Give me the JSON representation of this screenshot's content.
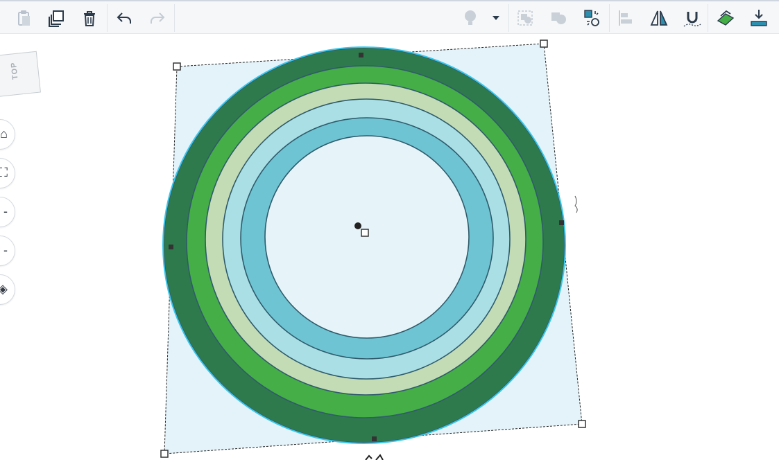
{
  "toolbar": {
    "left_tools": [
      {
        "name": "paste",
        "icon": "paste-icon",
        "enabled": false
      },
      {
        "name": "duplicate",
        "icon": "duplicate-icon",
        "enabled": true
      },
      {
        "name": "delete",
        "icon": "trash-icon",
        "enabled": true
      },
      {
        "name": "undo",
        "icon": "undo-icon",
        "enabled": true
      },
      {
        "name": "redo",
        "icon": "redo-icon",
        "enabled": false
      }
    ],
    "right_tools": [
      {
        "name": "light",
        "icon": "lightbulb-icon",
        "enabled": false
      },
      {
        "name": "light-dropdown",
        "icon": "caret-down-icon",
        "enabled": true
      },
      {
        "name": "group",
        "icon": "group-icon",
        "enabled": false
      },
      {
        "name": "ungroup",
        "icon": "ungroup-icon",
        "enabled": false
      },
      {
        "name": "cruise",
        "icon": "cruise-icon",
        "enabled": true
      },
      {
        "name": "align",
        "icon": "align-icon",
        "enabled": false
      },
      {
        "name": "mirror",
        "icon": "mirror-icon",
        "enabled": true
      },
      {
        "name": "magnet",
        "icon": "magnet-icon",
        "enabled": true
      },
      {
        "name": "workplane",
        "icon": "workplane-icon",
        "enabled": true
      },
      {
        "name": "drop",
        "icon": "drop-to-workplane-icon",
        "enabled": true
      }
    ]
  },
  "viewcube": {
    "face_label": "TOP"
  },
  "nav_controls": [
    {
      "name": "home-view",
      "glyph": "⌂"
    },
    {
      "name": "fit-view",
      "glyph": "⛶"
    },
    {
      "name": "zoom-in",
      "glyph": "-"
    },
    {
      "name": "zoom-out",
      "glyph": "-"
    },
    {
      "name": "perspective",
      "glyph": "◈"
    }
  ],
  "scene": {
    "colors": {
      "selection_fill": "#e4f3f9",
      "ring_dark_green": "#2f7a4c",
      "ring_green": "#45ae47",
      "ring_pale_green": "#c3dcb6",
      "ring_light_blue": "#aadfe6",
      "ring_teal": "#6ec4d3",
      "hole": "#e6f4f9",
      "outline": "#2f5b6b",
      "highlight": "#3bc6ea",
      "accent": "#1a73e8"
    },
    "rings": [
      {
        "name": "outer-ring",
        "fill_key": "ring_dark_green"
      },
      {
        "name": "ring-2",
        "fill_key": "ring_green"
      },
      {
        "name": "ring-3",
        "fill_key": "ring_pale_green"
      },
      {
        "name": "ring-4",
        "fill_key": "ring_light_blue"
      },
      {
        "name": "ring-5",
        "fill_key": "ring_teal"
      },
      {
        "name": "center-hole",
        "fill_key": "hole"
      }
    ]
  }
}
